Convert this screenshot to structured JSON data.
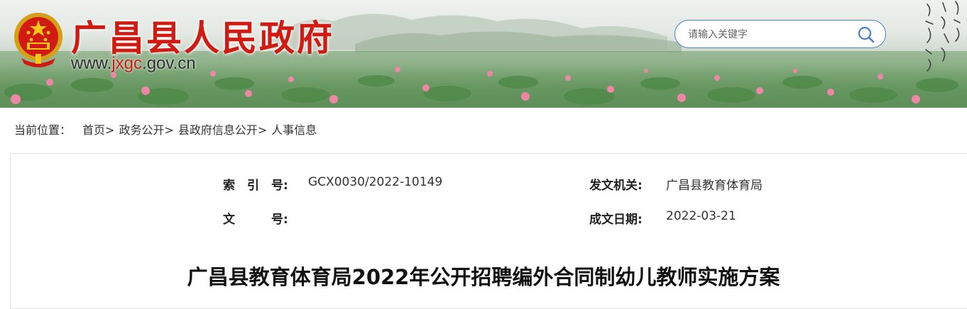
{
  "header": {
    "site_title": "广昌县人民政府",
    "url_prefix": "www.",
    "url_highlight": "jxgc",
    "url_suffix": ".gov.cn",
    "search": {
      "placeholder": "请输入关键字"
    }
  },
  "breadcrumb": {
    "prefix": "当前位置：",
    "items": [
      "首页>",
      "政务公开>",
      "县政府信息公开>",
      "人事信息"
    ]
  },
  "meta": {
    "index_label": "索　引　号:",
    "index_value": "GCX0030/2022-10149",
    "issuer_label": "发文机关:",
    "issuer_value": "广昌县教育体育局",
    "docno_label": "文　　　号:",
    "docno_value": "",
    "date_label": "成文日期:",
    "date_value": "2022-03-21"
  },
  "document": {
    "title": "广昌县教育体育局2022年公开招聘编外合同制幼儿教师实施方案"
  },
  "colors": {
    "title_red": "#d01a12",
    "search_border": "#4a7fc9"
  },
  "icons": {
    "emblem": "national-emblem-icon",
    "search": "search-icon"
  }
}
